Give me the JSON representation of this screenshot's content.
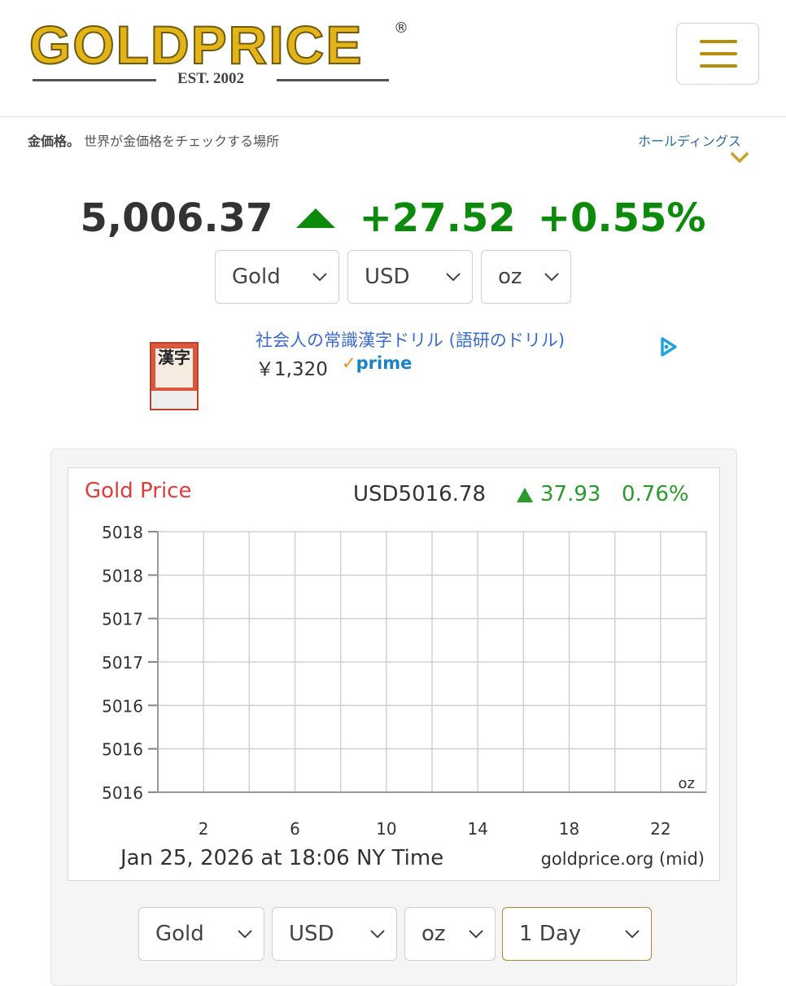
{
  "header": {
    "logo_text": "GOLDPRICE",
    "logo_registered": "®",
    "logo_est": "EST. 2002"
  },
  "tagline": {
    "bold": "金価格。",
    "text": "世界が金価格をチェックする場所"
  },
  "holdings_label": "ホールディングス",
  "price": {
    "value": "5,006.37",
    "change": "+27.52",
    "percent": "+0.55%",
    "direction": "up",
    "color": "#0b8a0b"
  },
  "selectors_top": {
    "metal": "Gold",
    "currency": "USD",
    "unit": "oz"
  },
  "ad": {
    "book_cover_text": "漢字",
    "title": "社会人の常識漢字ドリル (語研のドリル)",
    "price": "￥1,320",
    "prime_check": "✓",
    "prime": "prime"
  },
  "chart_data": {
    "type": "line",
    "title": "Gold Price",
    "title_color": "#e03c3c",
    "summary_price": "USD5016.78",
    "summary_change": "37.93",
    "summary_percent": "0.76%",
    "summary_color": "#2a9a2a",
    "yticks": [
      "5018",
      "5018",
      "5017",
      "5017",
      "5016",
      "5016",
      "5016"
    ],
    "xticks": [
      "2",
      "6",
      "10",
      "14",
      "18",
      "22"
    ],
    "x_tick_values": [
      2,
      6,
      10,
      14,
      18,
      22
    ],
    "xlim": [
      0,
      24
    ],
    "unit_label": "oz",
    "timestamp": "Jan 25, 2026 at 18:06 NY Time",
    "source": "goldprice.org (mid)",
    "grid": true,
    "x": [],
    "values": []
  },
  "selectors_bottom": {
    "metal": "Gold",
    "currency": "USD",
    "unit": "oz",
    "range": "1 Day",
    "range_border": "#a8873c"
  }
}
